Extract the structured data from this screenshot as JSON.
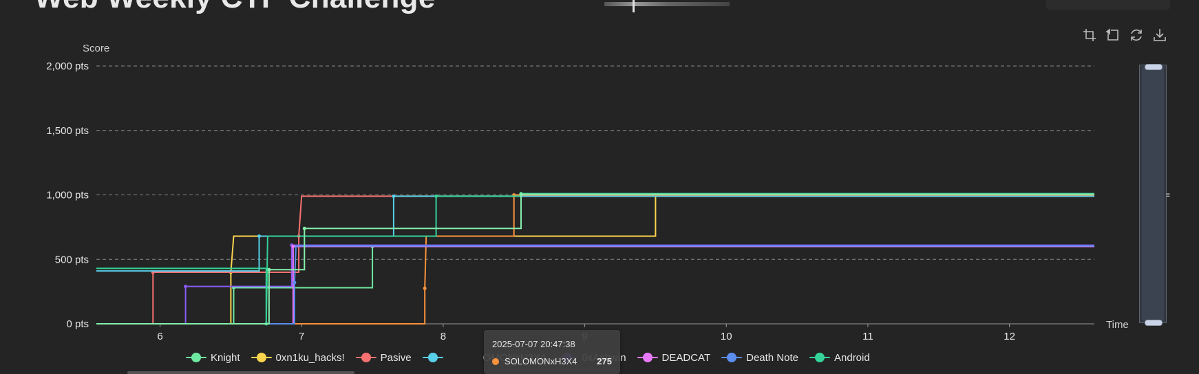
{
  "page": {
    "title": "Web Weekly CTF Challenge"
  },
  "toolbox": {
    "zoom_icon": "zoom-icon",
    "zoom_reset_icon": "zoom-reset-icon",
    "restore_icon": "restore-icon",
    "save_icon": "save-image-icon"
  },
  "tooltip": {
    "time": "2025-07-07 20:47:38",
    "series": "SOLOMONxH3X4",
    "value": "275",
    "color": "#fb923c"
  },
  "legend_fragment": "OMONxH3X4",
  "chart_data": {
    "type": "line",
    "step": true,
    "xlabel": "Time",
    "ylabel": "Score",
    "xlim": [
      5.55,
      12.6
    ],
    "ylim": [
      0,
      2000
    ],
    "x_ticks": [
      6,
      7,
      8,
      9,
      10,
      11,
      12
    ],
    "y_ticks": [
      0,
      500,
      1000,
      1500,
      2000
    ],
    "y_tick_labels": [
      "0 pts",
      "500 pts",
      "1,000 pts",
      "1,500 pts",
      "2,000 pts"
    ],
    "grid": "horizontal dashed",
    "legend_position": "bottom",
    "series": [
      {
        "name": "Knight",
        "color": "#6ee7a1",
        "points": [
          [
            5.55,
            0
          ],
          [
            6.52,
            0
          ],
          [
            6.52,
            280
          ],
          [
            7.5,
            280
          ],
          [
            7.5,
            600
          ],
          [
            12.6,
            600
          ]
        ]
      },
      {
        "name": "0xn1ku_hacks!",
        "color": "#fcd34d",
        "points": [
          [
            5.55,
            0
          ],
          [
            6.5,
            0
          ],
          [
            6.5,
            400
          ],
          [
            6.52,
            680
          ],
          [
            9.5,
            680
          ],
          [
            9.5,
            1000
          ],
          [
            12.6,
            1000
          ]
        ]
      },
      {
        "name": "Pasive",
        "color": "#f87171",
        "points": [
          [
            5.55,
            0
          ],
          [
            5.95,
            0
          ],
          [
            5.95,
            400
          ],
          [
            6.98,
            400
          ],
          [
            6.98,
            680
          ],
          [
            7.0,
            990
          ],
          [
            12.6,
            990
          ]
        ]
      },
      {
        "name": "",
        "color": "#58d0ea",
        "points": [
          [
            5.55,
            410
          ],
          [
            6.7,
            410
          ],
          [
            6.7,
            680
          ],
          [
            7.65,
            680
          ],
          [
            7.65,
            990
          ],
          [
            12.6,
            990
          ]
        ]
      },
      {
        "name": "SOLOMONxH3X4",
        "color": "#fb923c",
        "points": [
          [
            5.55,
            0
          ],
          [
            7.87,
            0
          ],
          [
            7.87,
            275
          ],
          [
            7.88,
            680
          ],
          [
            8.5,
            680
          ],
          [
            8.5,
            1000
          ],
          [
            12.6,
            1000
          ]
        ]
      },
      {
        "name": "0xAshwin",
        "color": "#8b5cf6",
        "points": [
          [
            5.55,
            0
          ],
          [
            6.18,
            0
          ],
          [
            6.18,
            290
          ],
          [
            6.93,
            290
          ],
          [
            6.93,
            610
          ],
          [
            12.6,
            610
          ]
        ]
      },
      {
        "name": "DEADCAT",
        "color": "#e879f9",
        "points": [
          [
            5.55,
            0
          ],
          [
            6.94,
            0
          ],
          [
            6.94,
            600
          ],
          [
            12.6,
            600
          ]
        ]
      },
      {
        "name": "Death Note",
        "color": "#5b8def",
        "points": [
          [
            5.55,
            0
          ],
          [
            6.95,
            0
          ],
          [
            6.95,
            320
          ],
          [
            6.96,
            605
          ],
          [
            12.6,
            605
          ]
        ]
      },
      {
        "name": "Android",
        "color": "#34d399",
        "points": [
          [
            5.55,
            430
          ],
          [
            6.75,
            430
          ],
          [
            6.75,
            0
          ],
          [
            6.76,
            680
          ],
          [
            7.95,
            680
          ],
          [
            7.95,
            990
          ],
          [
            8.55,
            990
          ],
          [
            8.55,
            1010
          ],
          [
            12.6,
            1010
          ]
        ]
      },
      {
        "name": "",
        "color": "#86efac",
        "points": [
          [
            5.55,
            0
          ],
          [
            6.77,
            0
          ],
          [
            6.77,
            420
          ],
          [
            7.02,
            420
          ],
          [
            7.02,
            740
          ],
          [
            8.55,
            740
          ],
          [
            8.55,
            1005
          ],
          [
            12.6,
            1005
          ]
        ]
      }
    ]
  }
}
